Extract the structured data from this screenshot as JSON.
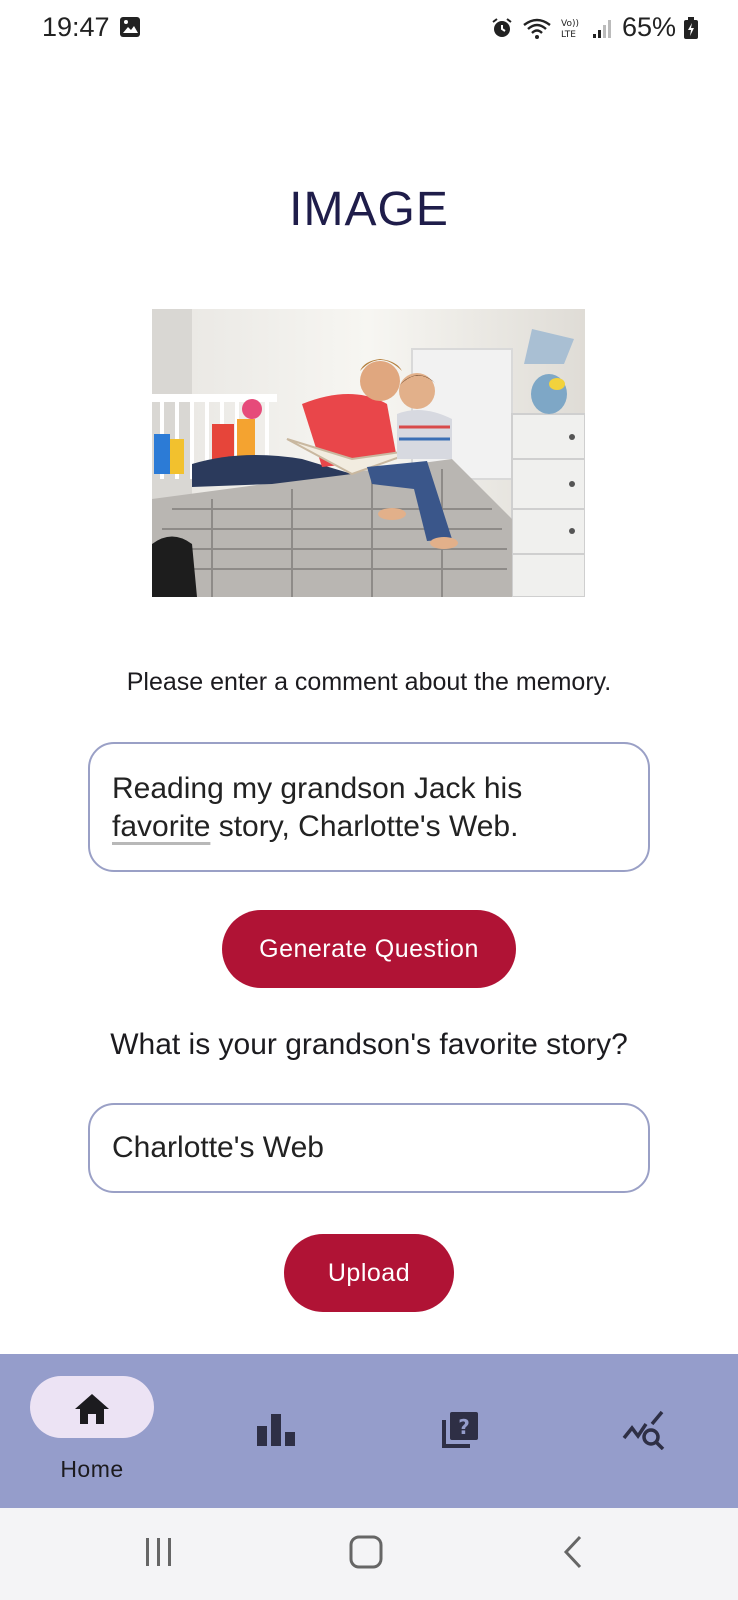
{
  "status_bar": {
    "time": "19:47",
    "battery": "65%",
    "icons": [
      "gallery-icon",
      "alarm-icon",
      "wifi-icon",
      "volte-icon",
      "signal-icon",
      "battery-icon"
    ]
  },
  "page": {
    "title": "IMAGE",
    "photo_alt": "memory-photo"
  },
  "comment": {
    "prompt": "Please enter a comment about the memory.",
    "value_line1": "Reading my grandson Jack his",
    "value_line2_underlined": "favorite",
    "value_line2_rest": " story, Charlotte's Web."
  },
  "buttons": {
    "generate": "Generate Question",
    "upload": "Upload"
  },
  "question": {
    "text": "What is your grandson's favorite story?",
    "answer_value": "Charlotte's Web"
  },
  "bottom_nav": {
    "items": [
      {
        "label": "Home",
        "icon": "home-icon",
        "selected": true
      },
      {
        "label": "",
        "icon": "bar-chart-icon",
        "selected": false
      },
      {
        "label": "",
        "icon": "quiz-icon",
        "selected": false
      },
      {
        "label": "",
        "icon": "query-stats-icon",
        "selected": false
      }
    ]
  },
  "colors": {
    "accent": "#b01335",
    "nav_background": "#959dcb",
    "nav_pill": "#ece3f4",
    "title": "#1f1d4a",
    "field_border": "#9aa0c6"
  }
}
